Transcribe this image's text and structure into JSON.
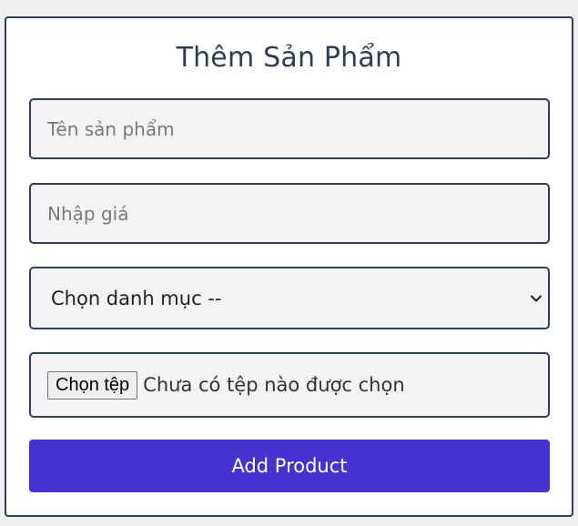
{
  "form": {
    "title": "Thêm Sản Phẩm",
    "name_placeholder": "Tên sản phẩm",
    "price_placeholder": "Nhập giá",
    "category_selected": "Chọn danh mục --",
    "file_button_label": "Chọn tệp",
    "file_status": "Chưa có tệp nào được chọn",
    "submit_label": "Add Product"
  },
  "colors": {
    "border": "#2f4058",
    "field_bg": "#f3f3f4",
    "button_bg": "#4631d2",
    "title_text": "#2e3e54"
  },
  "icons": {
    "select": "chevron-down-icon"
  }
}
